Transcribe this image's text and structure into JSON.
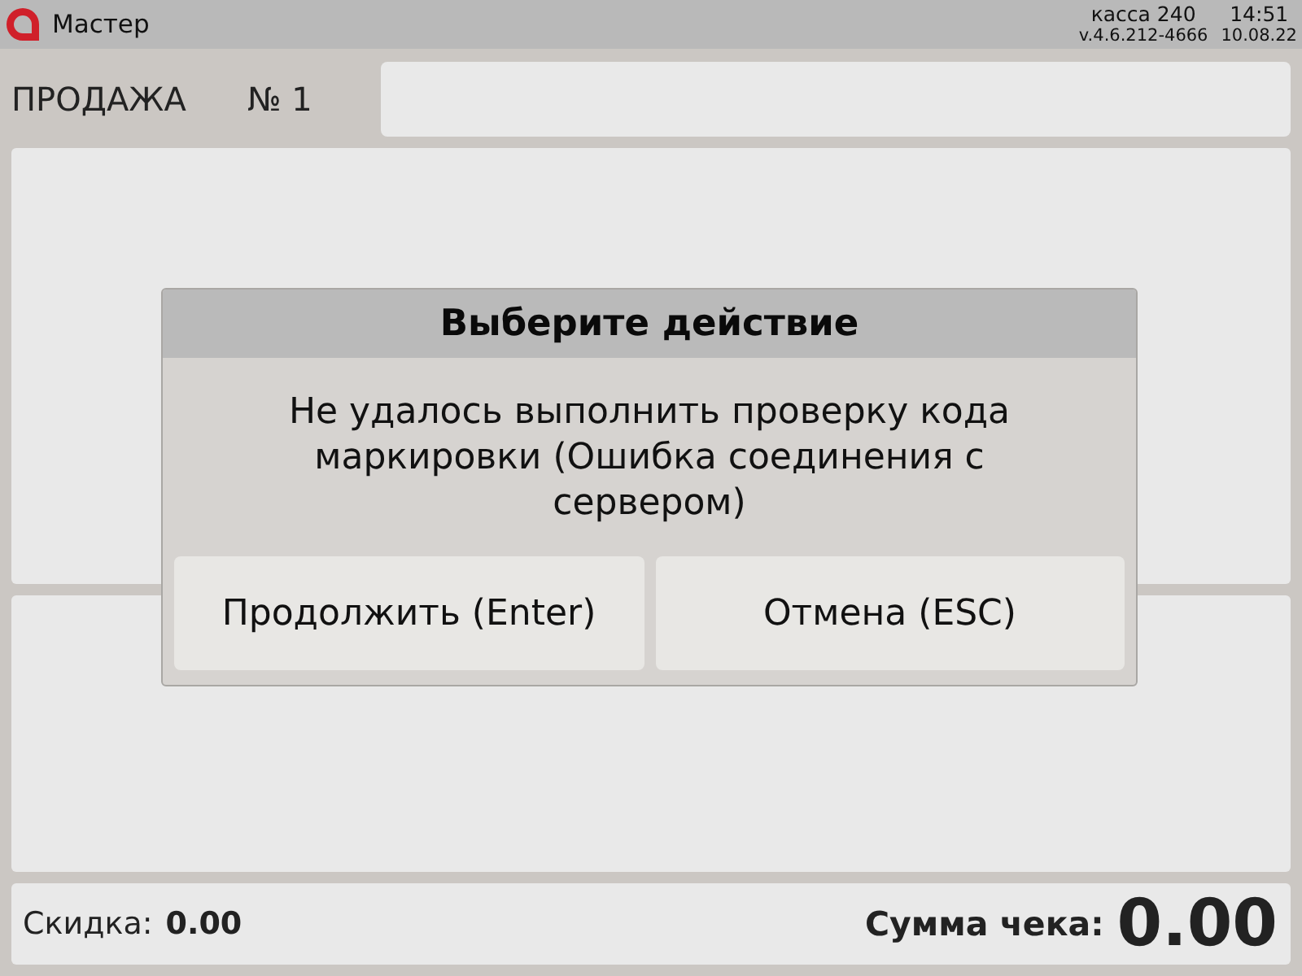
{
  "top_bar": {
    "app_title": "Мастер",
    "register": "касса 240",
    "time": "14:51",
    "version": "v.4.6.212-4666",
    "date": "10.08.22"
  },
  "header": {
    "title": "ПРОДАЖА",
    "receipt_number": "№ 1"
  },
  "footer": {
    "discount_label": "Скидка:",
    "discount_value": "0.00",
    "total_label": "Сумма чека:",
    "total_value": "0.00"
  },
  "dialog": {
    "title": "Выберите действие",
    "message": "Не удалось выполнить проверку кода маркировки (Ошибка соединения с сервером)",
    "buttons": [
      {
        "label": "Продолжить (Enter)"
      },
      {
        "label": "Отмена (ESC)"
      }
    ]
  }
}
